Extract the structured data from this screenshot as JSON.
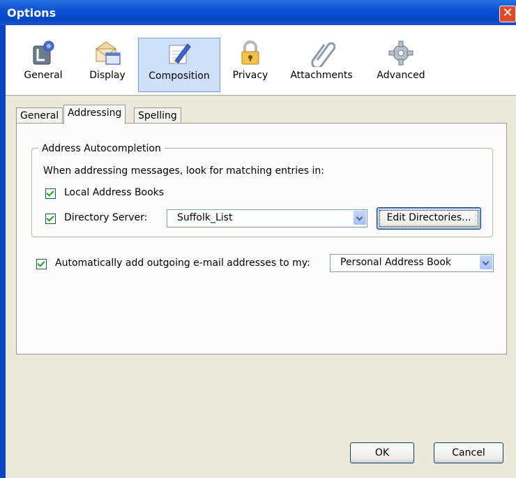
{
  "window": {
    "title": "Options",
    "close_glyph": "✕"
  },
  "toolbar": {
    "items": [
      {
        "label": "General",
        "icon": "general-icon"
      },
      {
        "label": "Display",
        "icon": "display-icon"
      },
      {
        "label": "Composition",
        "icon": "composition-icon",
        "selected": true
      },
      {
        "label": "Privacy",
        "icon": "privacy-lock-icon"
      },
      {
        "label": "Attachments",
        "icon": "paperclip-icon"
      },
      {
        "label": "Advanced",
        "icon": "gear-icon"
      }
    ]
  },
  "tabs": [
    {
      "label": "General"
    },
    {
      "label": "Addressing",
      "selected": true
    },
    {
      "label": "Spelling"
    }
  ],
  "autocomplete": {
    "legend": "Address Autocompletion",
    "description": "When addressing messages, look for matching entries in:",
    "local_books": {
      "label": "Local Address Books",
      "checked": true
    },
    "directory_server": {
      "label": "Directory Server:",
      "checked": true,
      "value": "Suffolk_List"
    },
    "edit_button": "Edit Directories..."
  },
  "auto_add": {
    "label": "Automatically add outgoing e-mail addresses to my:",
    "checked": true,
    "value": "Personal Address Book"
  },
  "buttons": {
    "ok": "OK",
    "cancel": "Cancel"
  },
  "colors": {
    "titlebar": "#0a4fd0",
    "selected_toolbar": "#cfdff8",
    "checkmark": "#21a121"
  }
}
